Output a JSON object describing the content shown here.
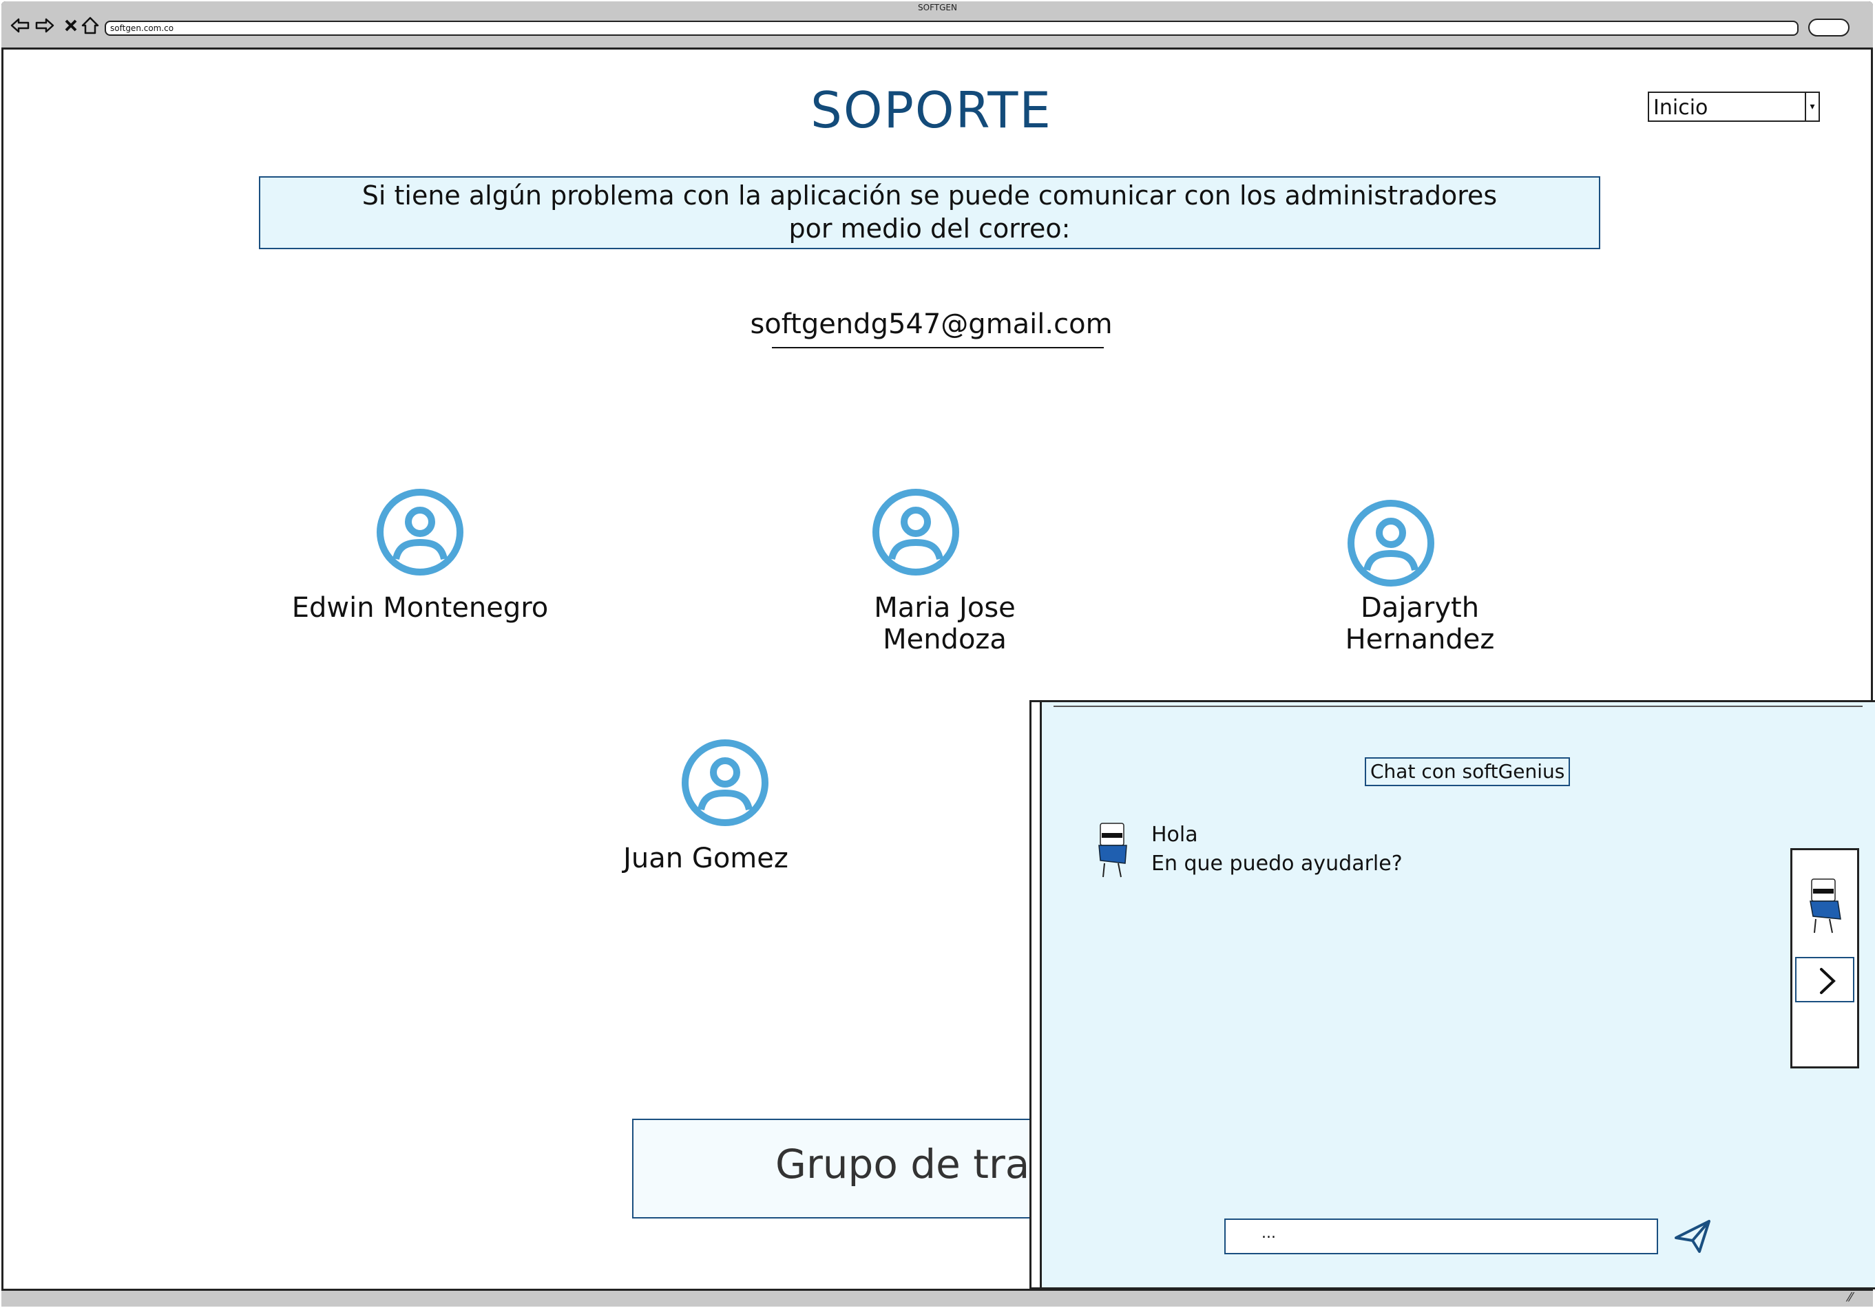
{
  "browser": {
    "title": "SOFTGEN",
    "url": "softgen.com.co",
    "nav_icons": [
      "back-icon",
      "forward-icon",
      "close-icon",
      "home-icon"
    ]
  },
  "header": {
    "title": "SOPORTE",
    "nav_select_value": "Inicio"
  },
  "notice": {
    "line1": "Si tiene algún problema con la aplicación se puede comunicar con los administradores",
    "line2": "por medio del correo:"
  },
  "contact": {
    "email": "softgendg547@gmail.com"
  },
  "team": [
    {
      "name": "Edwin Montenegro",
      "icon": "user-circle-icon"
    },
    {
      "name": "Maria Jose Mendoza",
      "icon": "user-circle-icon"
    },
    {
      "name": "Dajaryth Hernandez",
      "icon": "user-circle-icon"
    },
    {
      "name": "Juan Gomez",
      "icon": "user-circle-icon"
    }
  ],
  "group": {
    "label": "Grupo de trab"
  },
  "chat": {
    "title": "Chat con softGenius",
    "messages": [
      "Hola",
      "En que puedo ayudarle?"
    ],
    "input_value": "...",
    "send_icon": "paper-plane-icon",
    "next_icon": "chevron-right-icon"
  },
  "colors": {
    "title": "#134b7a",
    "accent_border": "#1a4f80",
    "panel_bg": "#e5f6fc",
    "avatar_blue": "#4ea6d9"
  }
}
